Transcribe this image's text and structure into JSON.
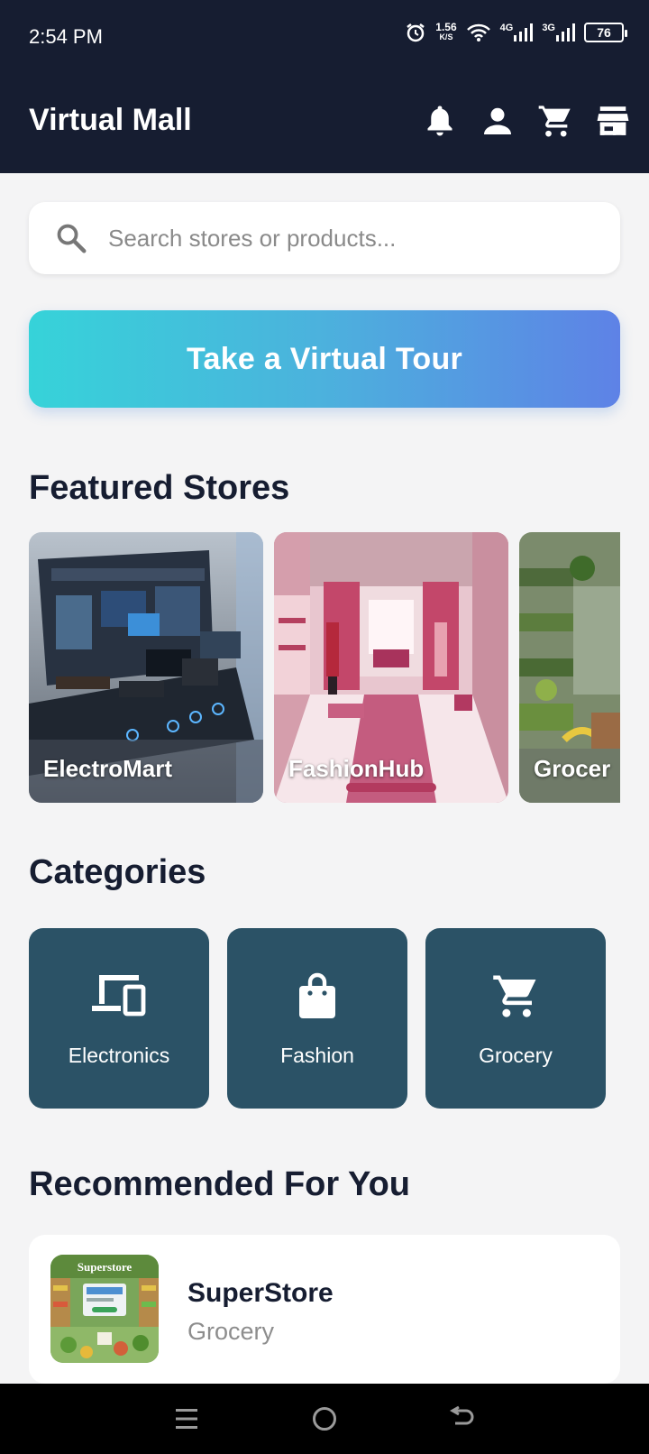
{
  "status_bar": {
    "time": "2:54 PM",
    "speed_value": "1.56",
    "speed_unit": "K/S",
    "network_1": "4G",
    "network_2": "3G",
    "battery": "76"
  },
  "app_bar": {
    "title": "Virtual Mall",
    "actions": [
      "bell-icon",
      "person-icon",
      "cart-icon",
      "store-icon"
    ]
  },
  "search": {
    "placeholder": "Search stores or products...",
    "value": ""
  },
  "tour_button": {
    "label": "Take a Virtual Tour"
  },
  "featured": {
    "title": "Featured Stores",
    "stores": [
      {
        "name": "ElectroMart"
      },
      {
        "name": "FashionHub"
      },
      {
        "name": "Grocer"
      }
    ]
  },
  "categories": {
    "title": "Categories",
    "items": [
      {
        "label": "Electronics",
        "icon": "devices-icon"
      },
      {
        "label": "Fashion",
        "icon": "shopping-bag-icon"
      },
      {
        "label": "Grocery",
        "icon": "cart-icon"
      }
    ]
  },
  "recommended": {
    "title": "Recommended For You",
    "items": [
      {
        "name": "SuperStore",
        "category": "Grocery",
        "thumb_text": "Superstore"
      }
    ]
  },
  "colors": {
    "header_bg": "#161d31",
    "category_bg": "#2b5266",
    "tour_gradient_start": "#36d3d9",
    "tour_gradient_end": "#5e82e6"
  }
}
